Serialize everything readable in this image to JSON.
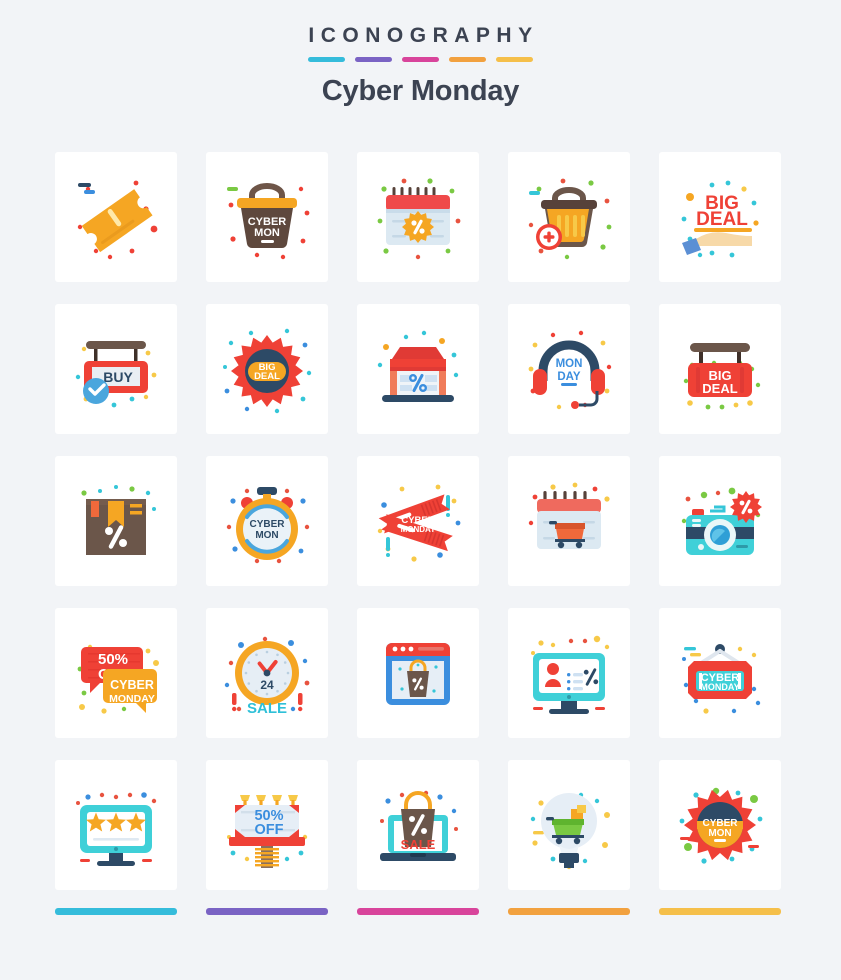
{
  "header": {
    "kicker": "ICONOGRAPHY",
    "title_bold": "Cyber",
    "title_regular": "Monday",
    "accent_dashes": [
      "#35bcdb",
      "#7a63c4",
      "#d8449b",
      "#f2a13f",
      "#f5bf4a"
    ]
  },
  "footer": {
    "bars": [
      "#35bcdb",
      "#7a63c4",
      "#d8449b",
      "#f2a13f",
      "#f5bf4a"
    ]
  },
  "palette": {
    "background": "#f2f4f7",
    "card": "#ffffff",
    "red": "#ef4136",
    "red_dark": "#e03a35",
    "orange": "#f5a623",
    "yellow": "#f7c948",
    "cyan": "#35c6d8",
    "blue": "#3b8ede",
    "navy": "#2d4a66",
    "brown": "#6e5548",
    "green": "#7ac943",
    "text_dark": "#3c4352"
  },
  "grid": {
    "columns": 5,
    "rows": 5,
    "icons": [
      {
        "id": "coupon-tag-icon",
        "label": "Coupon Tag",
        "text": "",
        "row": 1,
        "col": 1
      },
      {
        "id": "cyber-mon-basket-icon",
        "label": "Cyber Mon Basket",
        "text": "CYBER MON",
        "row": 1,
        "col": 2
      },
      {
        "id": "discount-calendar-icon",
        "label": "Discount Calendar",
        "text": "%",
        "row": 1,
        "col": 3
      },
      {
        "id": "add-to-basket-icon",
        "label": "Add To Basket",
        "text": "+",
        "row": 1,
        "col": 4
      },
      {
        "id": "big-deal-hand-icon",
        "label": "Big Deal Hand",
        "text": "BIG DEAL",
        "row": 1,
        "col": 5
      },
      {
        "id": "buy-signboard-icon",
        "label": "Buy Signboard",
        "text": "BUY",
        "row": 2,
        "col": 1
      },
      {
        "id": "big-deal-badge-icon",
        "label": "Big Deal Badge",
        "text": "BIG DEAL",
        "row": 2,
        "col": 2
      },
      {
        "id": "online-shop-discount-icon",
        "label": "Online Shop Discount",
        "text": "%",
        "row": 2,
        "col": 3
      },
      {
        "id": "monday-headset-icon",
        "label": "Monday Headset",
        "text": "MON DAY",
        "row": 2,
        "col": 4
      },
      {
        "id": "big-deal-hanging-sign-icon",
        "label": "Big Deal Hanging Sign",
        "text": "BIG DEAL",
        "row": 2,
        "col": 5
      },
      {
        "id": "discount-package-icon",
        "label": "Discount Package",
        "text": "%",
        "row": 3,
        "col": 1
      },
      {
        "id": "cyber-mon-stopwatch-icon",
        "label": "Cyber Mon Stopwatch",
        "text": "CYBER MON",
        "row": 3,
        "col": 2
      },
      {
        "id": "cyber-monday-tickets-icon",
        "label": "Cyber Monday Tickets",
        "text": "CYBER MONDAY",
        "row": 3,
        "col": 3
      },
      {
        "id": "cart-calendar-icon",
        "label": "Cart Calendar",
        "text": "",
        "row": 3,
        "col": 4
      },
      {
        "id": "camera-discount-icon",
        "label": "Camera Discount",
        "text": "%",
        "row": 3,
        "col": 5
      },
      {
        "id": "fifty-off-chat-icon",
        "label": "50% Off Chat Bubbles",
        "text": "50% OFF / CYBER MONDAY",
        "row": 4,
        "col": 1
      },
      {
        "id": "sale-clock-icon",
        "label": "24 Hour Sale Clock",
        "text": "24 SALE",
        "row": 4,
        "col": 2
      },
      {
        "id": "shopping-browser-icon",
        "label": "Shopping Browser",
        "text": "",
        "row": 4,
        "col": 3
      },
      {
        "id": "monitor-profile-discount-icon",
        "label": "Monitor Profile Discount",
        "text": "%",
        "row": 4,
        "col": 4
      },
      {
        "id": "cyber-monday-hanging-sign-icon",
        "label": "Cyber Monday Hanging Sign",
        "text": "CYBER MONDAY",
        "row": 4,
        "col": 5
      },
      {
        "id": "rating-monitor-icon",
        "label": "Rating Monitor",
        "text": "",
        "row": 5,
        "col": 1
      },
      {
        "id": "fifty-off-billboard-icon",
        "label": "50% Off Billboard",
        "text": "50% OFF",
        "row": 5,
        "col": 2
      },
      {
        "id": "laptop-sale-bag-icon",
        "label": "Laptop Sale Bag",
        "text": "SALE",
        "row": 5,
        "col": 3
      },
      {
        "id": "idea-cart-bulb-icon",
        "label": "Idea Cart Bulb",
        "text": "",
        "row": 5,
        "col": 4
      },
      {
        "id": "cyber-mon-badge-icon",
        "label": "Cyber Mon Badge",
        "text": "CYBER MON",
        "row": 5,
        "col": 5
      }
    ]
  }
}
